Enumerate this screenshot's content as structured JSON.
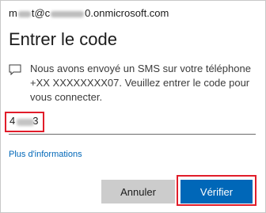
{
  "dialog": {
    "account": {
      "prefix": "m",
      "middle": "t@c",
      "suffix": "0.onmicrosoft.com"
    },
    "title": "Entrer le code",
    "message_icon": "sms-message-icon",
    "message": "Nous avons envoyé un SMS sur votre téléphone +XX XXXXXXXX07. Veuillez entrer le code pour vous connecter.",
    "code_input": {
      "value_start": "4",
      "value_end": "3",
      "placeholder": ""
    },
    "more_info_link": "Plus d'informations",
    "buttons": {
      "cancel": "Annuler",
      "verify": "Vérifier"
    },
    "colors": {
      "accent": "#0067b8",
      "highlight": "#e11d2a",
      "secondary_button": "#cccccc"
    }
  }
}
